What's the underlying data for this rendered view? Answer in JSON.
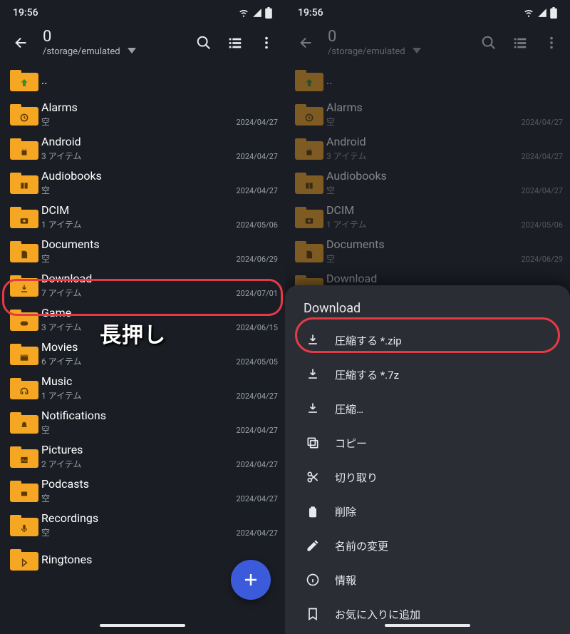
{
  "status": {
    "time": "19:56"
  },
  "header": {
    "count": "0",
    "path": "/storage/emulated"
  },
  "items": [
    {
      "name": "..",
      "sub": "",
      "date": "",
      "glyph": "up"
    },
    {
      "name": "Alarms",
      "sub": "空",
      "date": "2024/04/27",
      "glyph": "clock"
    },
    {
      "name": "Android",
      "sub": "3 アイテム",
      "date": "2024/04/27",
      "glyph": "android"
    },
    {
      "name": "Audiobooks",
      "sub": "空",
      "date": "2024/04/27",
      "glyph": "book"
    },
    {
      "name": "DCIM",
      "sub": "1 アイテム",
      "date": "2024/05/06",
      "glyph": "camera"
    },
    {
      "name": "Documents",
      "sub": "空",
      "date": "2024/06/29",
      "glyph": "doc"
    },
    {
      "name": "Download",
      "sub": "7 アイテム",
      "date": "2024/07/01",
      "glyph": "download"
    },
    {
      "name": "Game",
      "sub": "3 アイテム",
      "date": "2024/06/15",
      "glyph": "game"
    },
    {
      "name": "Movies",
      "sub": "6 アイテム",
      "date": "2024/05/05",
      "glyph": "movie"
    },
    {
      "name": "Music",
      "sub": "1 アイテム",
      "date": "2024/04/27",
      "glyph": "music"
    },
    {
      "name": "Notifications",
      "sub": "空",
      "date": "2024/04/27",
      "glyph": "bell"
    },
    {
      "name": "Pictures",
      "sub": "2 アイテム",
      "date": "2024/04/27",
      "glyph": "picture"
    },
    {
      "name": "Podcasts",
      "sub": "空",
      "date": "2024/04/27",
      "glyph": "podcast"
    },
    {
      "name": "Recordings",
      "sub": "空",
      "date": "2024/04/27",
      "glyph": "mic"
    },
    {
      "name": "Ringtones",
      "sub": "",
      "date": "",
      "glyph": "ringtone"
    }
  ],
  "annotation": "長押し",
  "sheet": {
    "title": "Download",
    "items": [
      "圧縮する *.zip",
      "圧縮する *.7z",
      "圧縮…",
      "コピー",
      "切り取り",
      "削除",
      "名前の変更",
      "情報",
      "お気に入りに追加"
    ]
  },
  "right_items_visible_count": 7
}
